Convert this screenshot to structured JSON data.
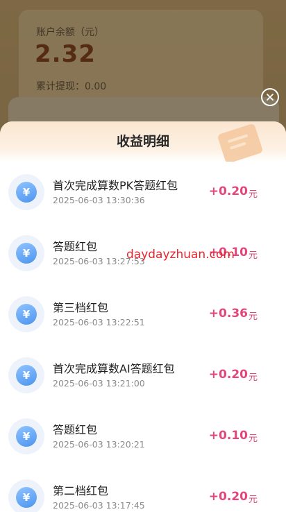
{
  "background": {
    "balance_label": "账户余额（元）",
    "balance_value": "2.32",
    "withdraw_text": "累计提现：0.00"
  },
  "modal": {
    "title": "收益明细",
    "close_icon": "close-icon",
    "items": [
      {
        "title": "首次完成算数PK答题红包",
        "time": "2025-06-03 13:30:36",
        "amount": "+0.20",
        "unit": "元",
        "icon": "yuan-coin-icon"
      },
      {
        "title": "答题红包",
        "time": "2025-06-03 13:27:53",
        "amount": "+0.10",
        "unit": "元",
        "icon": "yuan-coin-icon"
      },
      {
        "title": "第三档红包",
        "time": "2025-06-03 13:22:51",
        "amount": "+0.36",
        "unit": "元",
        "icon": "yuan-coin-icon"
      },
      {
        "title": "首次完成算数AI答题红包",
        "time": "2025-06-03 13:21:00",
        "amount": "+0.20",
        "unit": "元",
        "icon": "yuan-coin-icon"
      },
      {
        "title": "答题红包",
        "time": "2025-06-03 13:20:21",
        "amount": "+0.10",
        "unit": "元",
        "icon": "yuan-coin-icon"
      },
      {
        "title": "第二档红包",
        "time": "2025-06-03 13:17:45",
        "amount": "+0.20",
        "unit": "元",
        "icon": "yuan-coin-icon"
      }
    ]
  },
  "watermark": "daydayzhuan.com",
  "colors": {
    "amount": "#e2467a",
    "coin": "#4e95ef",
    "watermark": "#e8242b"
  }
}
